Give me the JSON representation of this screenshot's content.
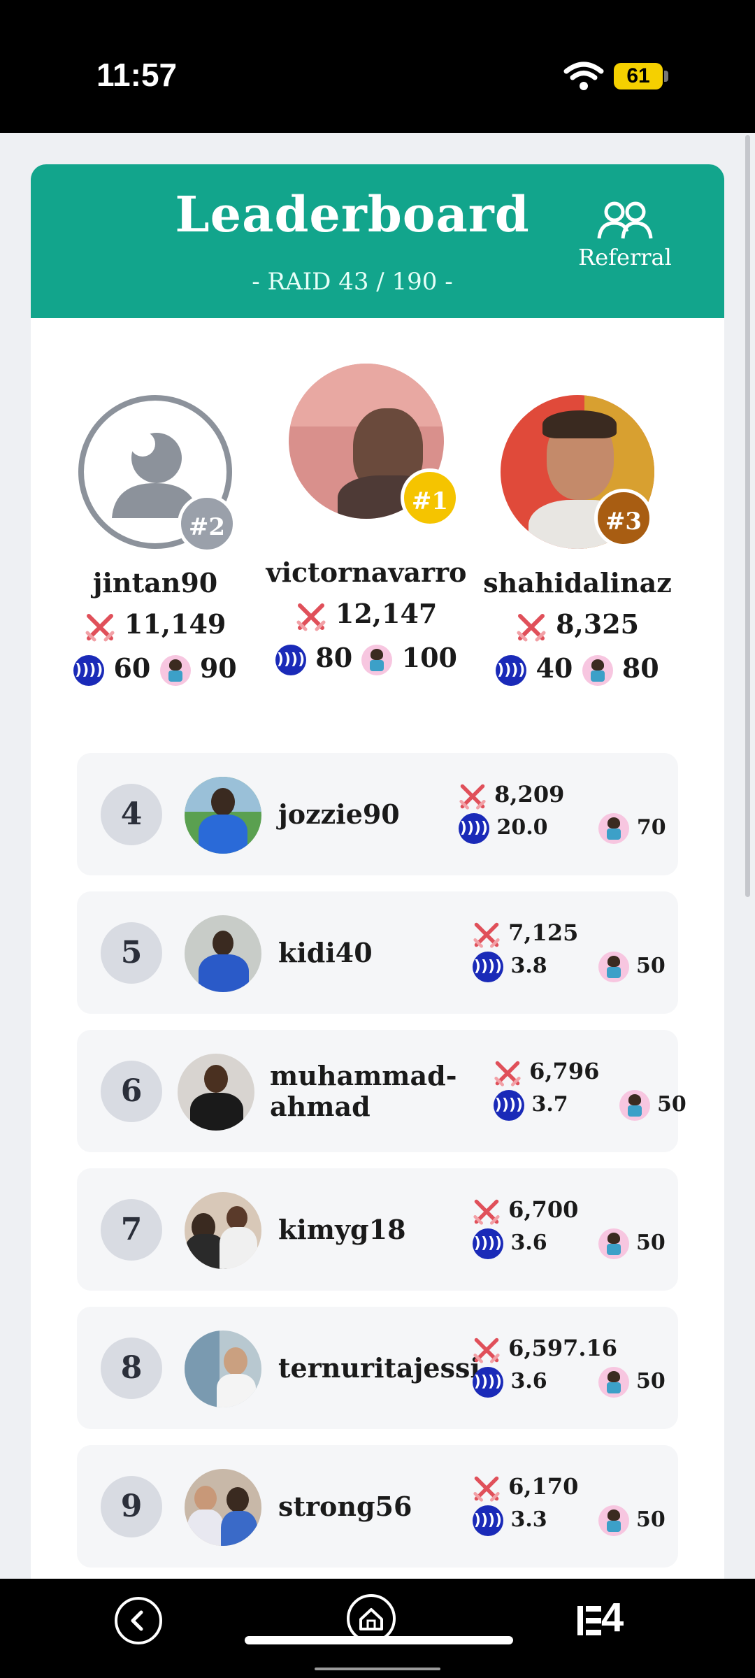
{
  "status_bar": {
    "time": "11:57",
    "battery": "61"
  },
  "header": {
    "title": "Leaderboard",
    "subtitle": "- RAID 43 / 190 -",
    "referral_label": "Referral"
  },
  "colors": {
    "header_bg": "#12a58c",
    "gold": "#f5c400",
    "silver": "#9aa0aa",
    "bronze": "#a85d12",
    "steem": "#1a2ab8"
  },
  "podium": [
    {
      "position": "second",
      "badge": "#2",
      "name": "jintan90",
      "score": "11,149",
      "steem": "60",
      "babies": "90"
    },
    {
      "position": "first",
      "badge": "#1",
      "name": "victornavarro",
      "score": "12,147",
      "steem": "80",
      "babies": "100"
    },
    {
      "position": "third",
      "badge": "#3",
      "name": "shahidalinaz",
      "score": "8,325",
      "steem": "40",
      "babies": "80"
    }
  ],
  "rows": [
    {
      "rank": "4",
      "name": "jozzie90",
      "score": "8,209",
      "steem": "20.0",
      "babies": "70"
    },
    {
      "rank": "5",
      "name": "kidi40",
      "score": "7,125",
      "steem": "3.8",
      "babies": "50"
    },
    {
      "rank": "6",
      "name": "muhammad-ahmad",
      "name_line1": "muhammad-",
      "name_line2": "ahmad",
      "score": "6,796",
      "steem": "3.7",
      "babies": "50"
    },
    {
      "rank": "7",
      "name": "kimyg18",
      "score": "6,700",
      "steem": "3.6",
      "babies": "50"
    },
    {
      "rank": "8",
      "name": "ternuritajessi",
      "score": "6,597.16",
      "steem": "3.6",
      "babies": "50"
    },
    {
      "rank": "9",
      "name": "strong56",
      "score": "6,170",
      "steem": "3.3",
      "babies": "50"
    }
  ],
  "nav": {
    "menu_label": "☰4",
    "menu_text": "4"
  }
}
